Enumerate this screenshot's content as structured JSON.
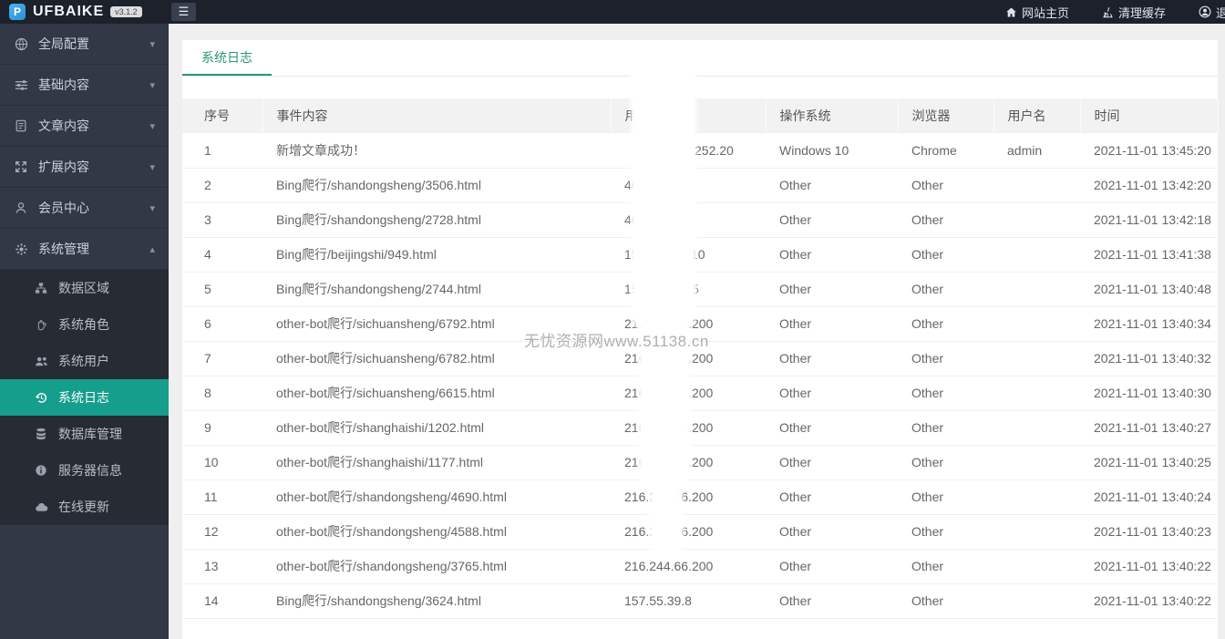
{
  "header": {
    "logo_text": "UFBAIKE",
    "version_badge": "v3.1.2",
    "nav": [
      {
        "icon": "home-icon",
        "label": "网站主页"
      },
      {
        "icon": "clean-icon",
        "label": "清理缓存"
      },
      {
        "icon": "user-circle-icon",
        "label": "退出"
      }
    ]
  },
  "sidebar": {
    "items": [
      {
        "label": "全局配置",
        "icon": "globe-icon",
        "expanded": false
      },
      {
        "label": "基础内容",
        "icon": "sliders-icon",
        "expanded": false
      },
      {
        "label": "文章内容",
        "icon": "document-icon",
        "expanded": false
      },
      {
        "label": "扩展内容",
        "icon": "expand-icon",
        "expanded": false
      },
      {
        "label": "会员中心",
        "icon": "user-icon",
        "expanded": false
      },
      {
        "label": "系统管理",
        "icon": "gear-icon",
        "expanded": true,
        "children": [
          {
            "label": "数据区域",
            "icon": "sitemap-icon",
            "active": false
          },
          {
            "label": "系统角色",
            "icon": "hand-icon",
            "active": false
          },
          {
            "label": "系统用户",
            "icon": "users-icon",
            "active": false
          },
          {
            "label": "系统日志",
            "icon": "history-icon",
            "active": true
          },
          {
            "label": "数据库管理",
            "icon": "database-icon",
            "active": false
          },
          {
            "label": "服务器信息",
            "icon": "info-icon",
            "active": false
          },
          {
            "label": "在线更新",
            "icon": "cloud-icon",
            "active": false
          }
        ]
      }
    ]
  },
  "main": {
    "tab": "系统日志",
    "table": {
      "columns": [
        "序号",
        "事件内容",
        "用户IP",
        "操作系统",
        "浏览器",
        "用户名",
        "时间"
      ],
      "rows": [
        {
          "no": "1",
          "event": "新增文章成功！",
          "ip": "252.20",
          "os": "Windows 10",
          "browser": "Chrome",
          "username": "admin",
          "time": "2021-11-01 13:45:20"
        },
        {
          "no": "2",
          "event": "Bing爬行/shandongsheng/3506.html",
          "ip": "40.77.167.3",
          "os": "Other",
          "browser": "Other",
          "username": "",
          "time": "2021-11-01 13:42:20"
        },
        {
          "no": "3",
          "event": "Bing爬行/shandongsheng/2728.html",
          "ip": "40.77.167.3",
          "os": "Other",
          "browser": "Other",
          "username": "",
          "time": "2021-11-01 13:42:18"
        },
        {
          "no": "4",
          "event": "Bing爬行/beijingshi/949.html",
          "ip": "157.55.39.110",
          "os": "Other",
          "browser": "Other",
          "username": "",
          "time": "2021-11-01 13:41:38"
        },
        {
          "no": "5",
          "event": "Bing爬行/shandongsheng/2744.html",
          "ip": "157.55.39.55",
          "os": "Other",
          "browser": "Other",
          "username": "",
          "time": "2021-11-01 13:40:48"
        },
        {
          "no": "6",
          "event": "other-bot爬行/sichuansheng/6792.html",
          "ip": "216.244.66.200",
          "os": "Other",
          "browser": "Other",
          "username": "",
          "time": "2021-11-01 13:40:34"
        },
        {
          "no": "7",
          "event": "other-bot爬行/sichuansheng/6782.html",
          "ip": "216.244.66.200",
          "os": "Other",
          "browser": "Other",
          "username": "",
          "time": "2021-11-01 13:40:32"
        },
        {
          "no": "8",
          "event": "other-bot爬行/sichuansheng/6615.html",
          "ip": "216.244.66.200",
          "os": "Other",
          "browser": "Other",
          "username": "",
          "time": "2021-11-01 13:40:30"
        },
        {
          "no": "9",
          "event": "other-bot爬行/shanghaishi/1202.html",
          "ip": "216.244.66.200",
          "os": "Other",
          "browser": "Other",
          "username": "",
          "time": "2021-11-01 13:40:27"
        },
        {
          "no": "10",
          "event": "other-bot爬行/shanghaishi/1177.html",
          "ip": "216.244.66.200",
          "os": "Other",
          "browser": "Other",
          "username": "",
          "time": "2021-11-01 13:40:25"
        },
        {
          "no": "11",
          "event": "other-bot爬行/shandongsheng/4690.html",
          "ip": "216.244.66.200",
          "os": "Other",
          "browser": "Other",
          "username": "",
          "time": "2021-11-01 13:40:24"
        },
        {
          "no": "12",
          "event": "other-bot爬行/shandongsheng/4588.html",
          "ip": "216.244.66.200",
          "os": "Other",
          "browser": "Other",
          "username": "",
          "time": "2021-11-01 13:40:23"
        },
        {
          "no": "13",
          "event": "other-bot爬行/shandongsheng/3765.html",
          "ip": "216.244.66.200",
          "os": "Other",
          "browser": "Other",
          "username": "",
          "time": "2021-11-01 13:40:22"
        },
        {
          "no": "14",
          "event": "Bing爬行/shandongsheng/3624.html",
          "ip": "157.55.39.8",
          "os": "Other",
          "browser": "Other",
          "username": "",
          "time": "2021-11-01 13:40:22"
        }
      ]
    }
  },
  "watermark": "无忧资源网www.51138.cn",
  "colors": {
    "header_bg": "#1c212b",
    "sidebar_bg": "#323846",
    "submenu_bg": "#272b34",
    "active_item_bg": "#169e8c",
    "tab_accent": "#2c9678",
    "table_header_bg": "#f2f2f2"
  }
}
